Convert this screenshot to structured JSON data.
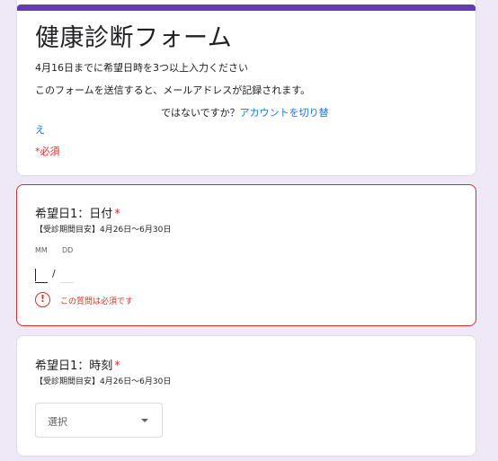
{
  "header": {
    "title": "健康診断フォーム",
    "description": "4月16日までに希望日時を3つ以上入力ください",
    "email_notice": "このフォームを送信すると、メールアドレスが記録されます。",
    "account_prefix": "ではないですか？",
    "account_link": "アカウントを切り替",
    "account_link_cont": "え",
    "required_note": "*必須"
  },
  "date_question": {
    "title": "希望日1：日付",
    "required_mark": "*",
    "subtitle": "【受診期間目安】4月26日〜6月30日",
    "month_label": "MM",
    "day_label": "DD",
    "separator": "/",
    "error_icon": "!",
    "error_message": "この質問は必須です"
  },
  "time_question": {
    "title": "希望日1：時刻",
    "required_mark": "*",
    "subtitle": "【受診期間目安】4月26日〜6月30日",
    "select_value": "選択"
  },
  "colors": {
    "accent": "#673ab7",
    "error": "#d93025",
    "link": "#1a73e8",
    "background": "#efe9f7"
  }
}
